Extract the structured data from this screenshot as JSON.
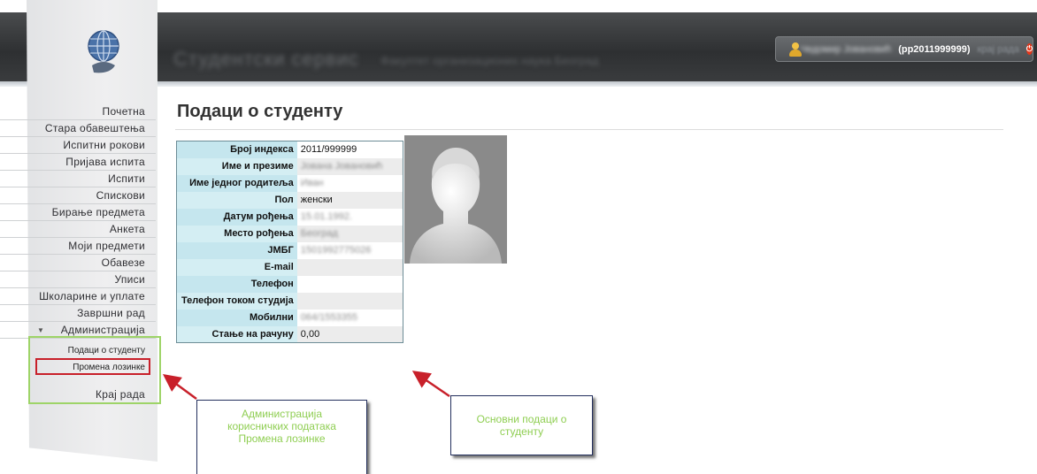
{
  "header": {
    "title": "Студентски сервис",
    "subtitle": "Факултет организационих наука Београд",
    "user_name": "Чедомир Јовановић",
    "user_id": "(pp2011999999)",
    "logout_label": "крај рада",
    "power_icon": "power-icon"
  },
  "sidebar": {
    "items": [
      {
        "label": "Почетна"
      },
      {
        "label": "Стара обавештења"
      },
      {
        "label": "Испитни рокови"
      },
      {
        "label": "Пријава испита"
      },
      {
        "label": "Испити"
      },
      {
        "label": "Спискови"
      },
      {
        "label": "Бирање предмета"
      },
      {
        "label": "Анкета"
      },
      {
        "label": "Моји предмети"
      },
      {
        "label": "Обавезе"
      },
      {
        "label": "Уписи"
      },
      {
        "label": "Школарине и уплате"
      },
      {
        "label": "Завршни рад"
      }
    ],
    "admin": {
      "label": "Администрација",
      "expanded": true,
      "sub_items": [
        {
          "label": "Подаци о студенту",
          "active": true
        },
        {
          "label": "Промена лозинке"
        }
      ]
    },
    "end_label": "Крај рада"
  },
  "main": {
    "page_title": "Подаци о студенту",
    "rows": [
      {
        "label": "Број индекса",
        "value": "2011/999999"
      },
      {
        "label": "Име и презиме",
        "value": "Јована Јовановић",
        "blurred": true
      },
      {
        "label": "Име једног родитеља",
        "value": "Иван",
        "blurred": true
      },
      {
        "label": "Пол",
        "value": "женски"
      },
      {
        "label": "Датум рођења",
        "value": "15.01.1992.",
        "blurred": true
      },
      {
        "label": "Место рођења",
        "value": "Београд",
        "blurred": true
      },
      {
        "label": "ЈМБГ",
        "value": "1501992775026",
        "blurred": true
      },
      {
        "label": "E-mail",
        "value": ""
      },
      {
        "label": "Телефон",
        "value": ""
      },
      {
        "label": "Телефон током студија",
        "value": ""
      },
      {
        "label": "Мобилни",
        "value": "064/1553355",
        "blurred": true
      },
      {
        "label": "Стање на рачуну",
        "value": "0,00"
      }
    ]
  },
  "annotations": {
    "admin_callout": [
      "Администрација",
      "корисничких података",
      "Промена лозинке"
    ],
    "basic_callout": [
      "Основни подаци о",
      "студенту"
    ],
    "color": "#8fce52"
  },
  "colors": {
    "header": "#2e3032",
    "table_label_bg": "#c8eaf0",
    "highlight_green": "#9ed468",
    "highlight_red": "#c8202a",
    "arrow": "#c8202a"
  }
}
